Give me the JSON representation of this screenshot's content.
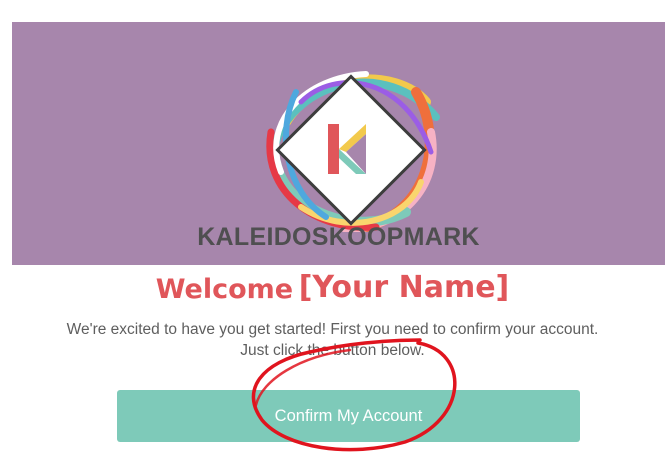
{
  "header": {
    "brand_name": "KALEIDOSKOOPMARK",
    "logo_letter": "K",
    "banner_color": "#a786ac"
  },
  "main": {
    "welcome_word": "Welcome",
    "name_placeholder": "[Your Name]",
    "intro_line_1": "We're excited to have you get started! First you need to confirm your account.",
    "intro_line_2": "Just click the button below.",
    "confirm_button_label": "Confirm My Account"
  },
  "colors": {
    "accent_red": "#e0565a",
    "button_teal": "#7ecab9",
    "text_gray": "#5e5e5e",
    "annotation_red": "#e0141e"
  }
}
